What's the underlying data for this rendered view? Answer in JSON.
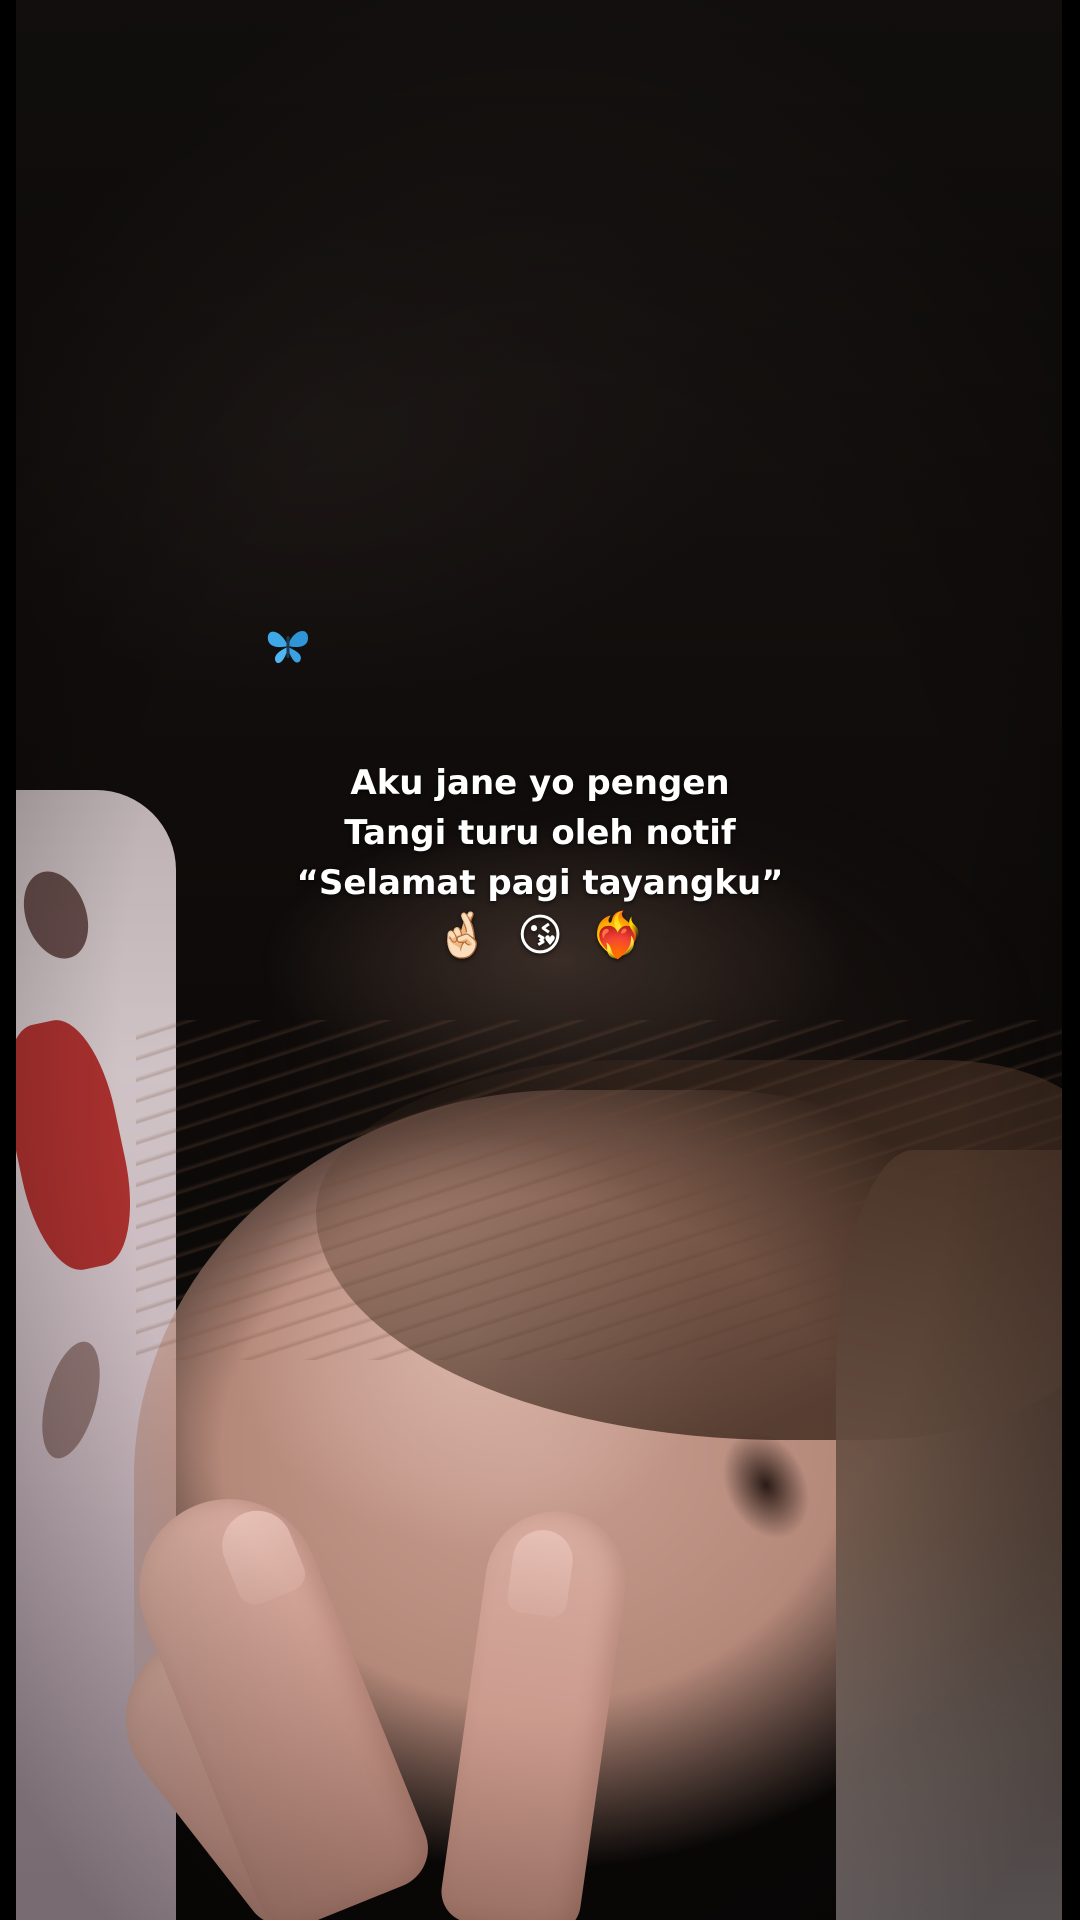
{
  "caption": {
    "lines": [
      "Aku jane yo pengen",
      "Tangi turu oleh notif",
      "“Selamat pagi tayangku”"
    ],
    "emojis": [
      "🤞🏻",
      "😘",
      "❤️‍🔥"
    ]
  },
  "decorations": {
    "butterfly_icon": "butterfly-icon",
    "butterfly_color": "#3fa9e8"
  },
  "photo": {
    "subject_icon": "photo-icon"
  }
}
